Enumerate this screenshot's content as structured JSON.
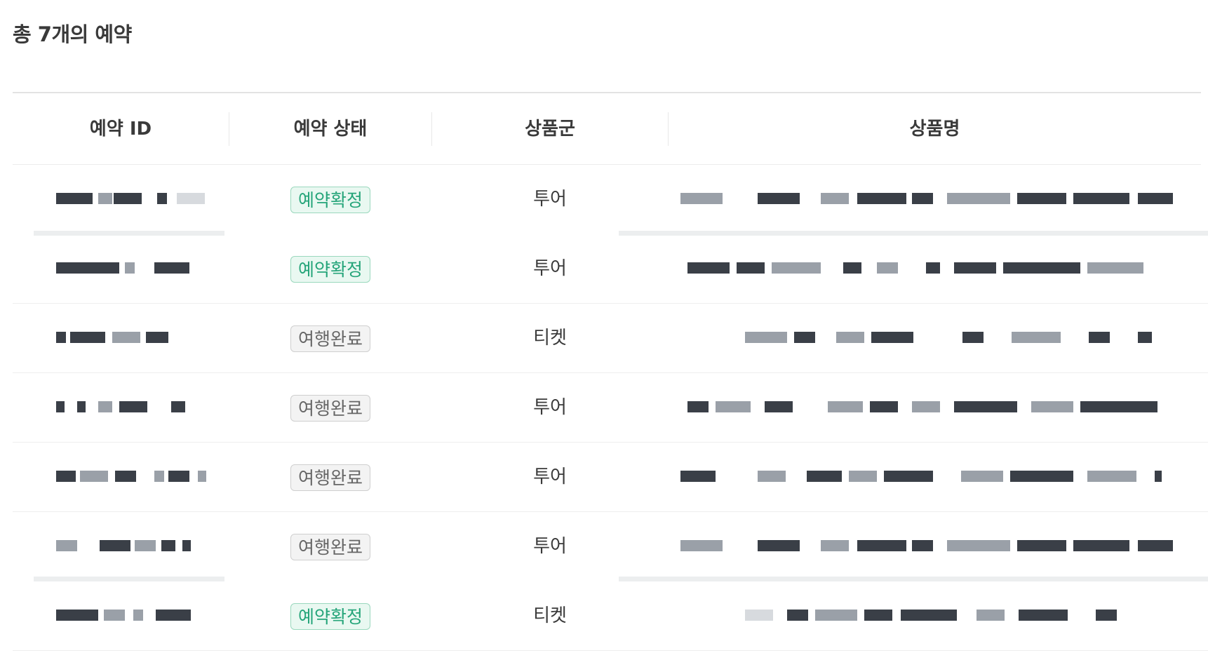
{
  "summary": {
    "total_label": "총 7개의 예약"
  },
  "table": {
    "columns": [
      "예약 ID",
      "예약 상태",
      "상품군",
      "상품명"
    ],
    "rows": [
      {
        "status": "예약확정",
        "status_type": "confirmed",
        "category": "투어"
      },
      {
        "status": "예약확정",
        "status_type": "confirmed",
        "category": "투어"
      },
      {
        "status": "여행완료",
        "status_type": "completed",
        "category": "티켓"
      },
      {
        "status": "여행완료",
        "status_type": "completed",
        "category": "투어"
      },
      {
        "status": "여행완료",
        "status_type": "completed",
        "category": "투어"
      },
      {
        "status": "여행완료",
        "status_type": "completed",
        "category": "투어"
      },
      {
        "status": "예약확정",
        "status_type": "confirmed",
        "category": "티켓"
      }
    ]
  },
  "colors": {
    "confirmed_text": "#26a57a",
    "confirmed_bg": "#e9f8f1",
    "completed_text": "#666666",
    "completed_bg": "#f3f3f3"
  }
}
